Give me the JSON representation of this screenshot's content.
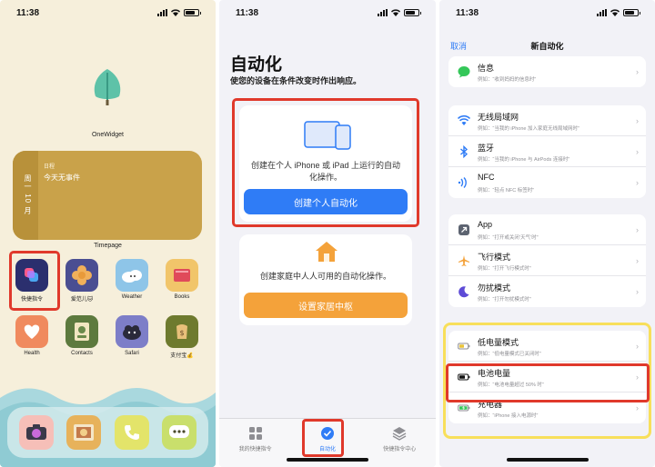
{
  "status_time": "11:38",
  "home": {
    "onewidget_label": "OneWidget",
    "calendar": {
      "date_vertical": "周一 10 月",
      "header": "日程",
      "event": "今天无事件"
    },
    "timepage_label": "Timepage",
    "apps": [
      {
        "label": "快捷指令",
        "color": "#3b3f8f",
        "icon": "shortcuts-icon"
      },
      {
        "label": "爱范儿🐱",
        "color": "#4a4e92",
        "icon": "flower-icon"
      },
      {
        "label": "Weather",
        "color": "#8ec5e8",
        "icon": "weather-icon"
      },
      {
        "label": "Books",
        "color": "#f1c56a",
        "icon": "books-icon"
      },
      {
        "label": "Health",
        "color": "#f08a5e",
        "icon": "heart-icon"
      },
      {
        "label": "Contacts",
        "color": "#6a8a4a",
        "icon": "contacts-icon"
      },
      {
        "label": "Safari",
        "color": "#7d7ec8",
        "icon": "safari-icon"
      },
      {
        "label": "支付宝💰",
        "color": "#8b8f3a",
        "icon": "alipay-icon"
      }
    ],
    "dock": [
      {
        "name": "camera",
        "color": "#f6bfb8"
      },
      {
        "name": "photos",
        "color": "#e7b25b"
      },
      {
        "name": "phone",
        "color": "#e3e46a"
      },
      {
        "name": "messages",
        "color": "#c9df6c"
      }
    ]
  },
  "automation": {
    "title": "自动化",
    "subtitle": "使您的设备在条件改变时作出响应。",
    "personal_text": "创建在个人 iPhone 或 iPad 上运行的自动化操作。",
    "personal_button": "创建个人自动化",
    "home_text": "创建家庭中人人可用的自动化操作。",
    "home_button": "设置家居中枢",
    "tabs": [
      {
        "label": "我的快捷指令",
        "active": false
      },
      {
        "label": "自动化",
        "active": true
      },
      {
        "label": "快捷指令中心",
        "active": false
      }
    ]
  },
  "new_automation": {
    "cancel": "取消",
    "title": "新自动化",
    "groups": [
      [
        {
          "title": "信息",
          "sub": "例如：“收到妈妈的信息时”",
          "icon": "message-icon",
          "color": "#34c759"
        }
      ],
      [
        {
          "title": "无线局域网",
          "sub": "例如：“当我的 iPhone 加入家庭无线局域网时”",
          "icon": "wifi-icon",
          "color": "#2f7cf6"
        },
        {
          "title": "蓝牙",
          "sub": "例如：“当我的 iPhone 与 AirPods 连接时”",
          "icon": "bluetooth-icon",
          "color": "#2f7cf6"
        },
        {
          "title": "NFC",
          "sub": "例如：“轻点 NFC 标签时”",
          "icon": "nfc-icon",
          "color": "#2f7cf6"
        }
      ],
      [
        {
          "title": "App",
          "sub": "例如：“打开或关闭‘天气’时”",
          "icon": "app-icon",
          "color": "#5c6370"
        },
        {
          "title": "飞行模式",
          "sub": "例如：“打开飞行模式时”",
          "icon": "airplane-icon",
          "color": "#f4a23a"
        },
        {
          "title": "勿扰模式",
          "sub": "例如：“打开勿扰模式时”",
          "icon": "moon-icon",
          "color": "#5e4bd6"
        }
      ],
      [
        {
          "title": "低电量模式",
          "sub": "例如：“低电量模式已关闭时”",
          "icon": "battery-low-icon",
          "color": "#e9c43a"
        },
        {
          "title": "电池电量",
          "sub": "例如：“电池电量超过 50% 时”",
          "icon": "battery-level-icon",
          "color": "#111111"
        },
        {
          "title": "充电器",
          "sub": "例如：“iPhone 接入电源时”",
          "icon": "charger-icon",
          "color": "#34c759"
        }
      ]
    ]
  },
  "colors": {
    "accent": "#2f7cf6",
    "highlight_red": "#e0392b",
    "highlight_yellow": "#f8df5b",
    "home_button": "#f4a23a"
  }
}
